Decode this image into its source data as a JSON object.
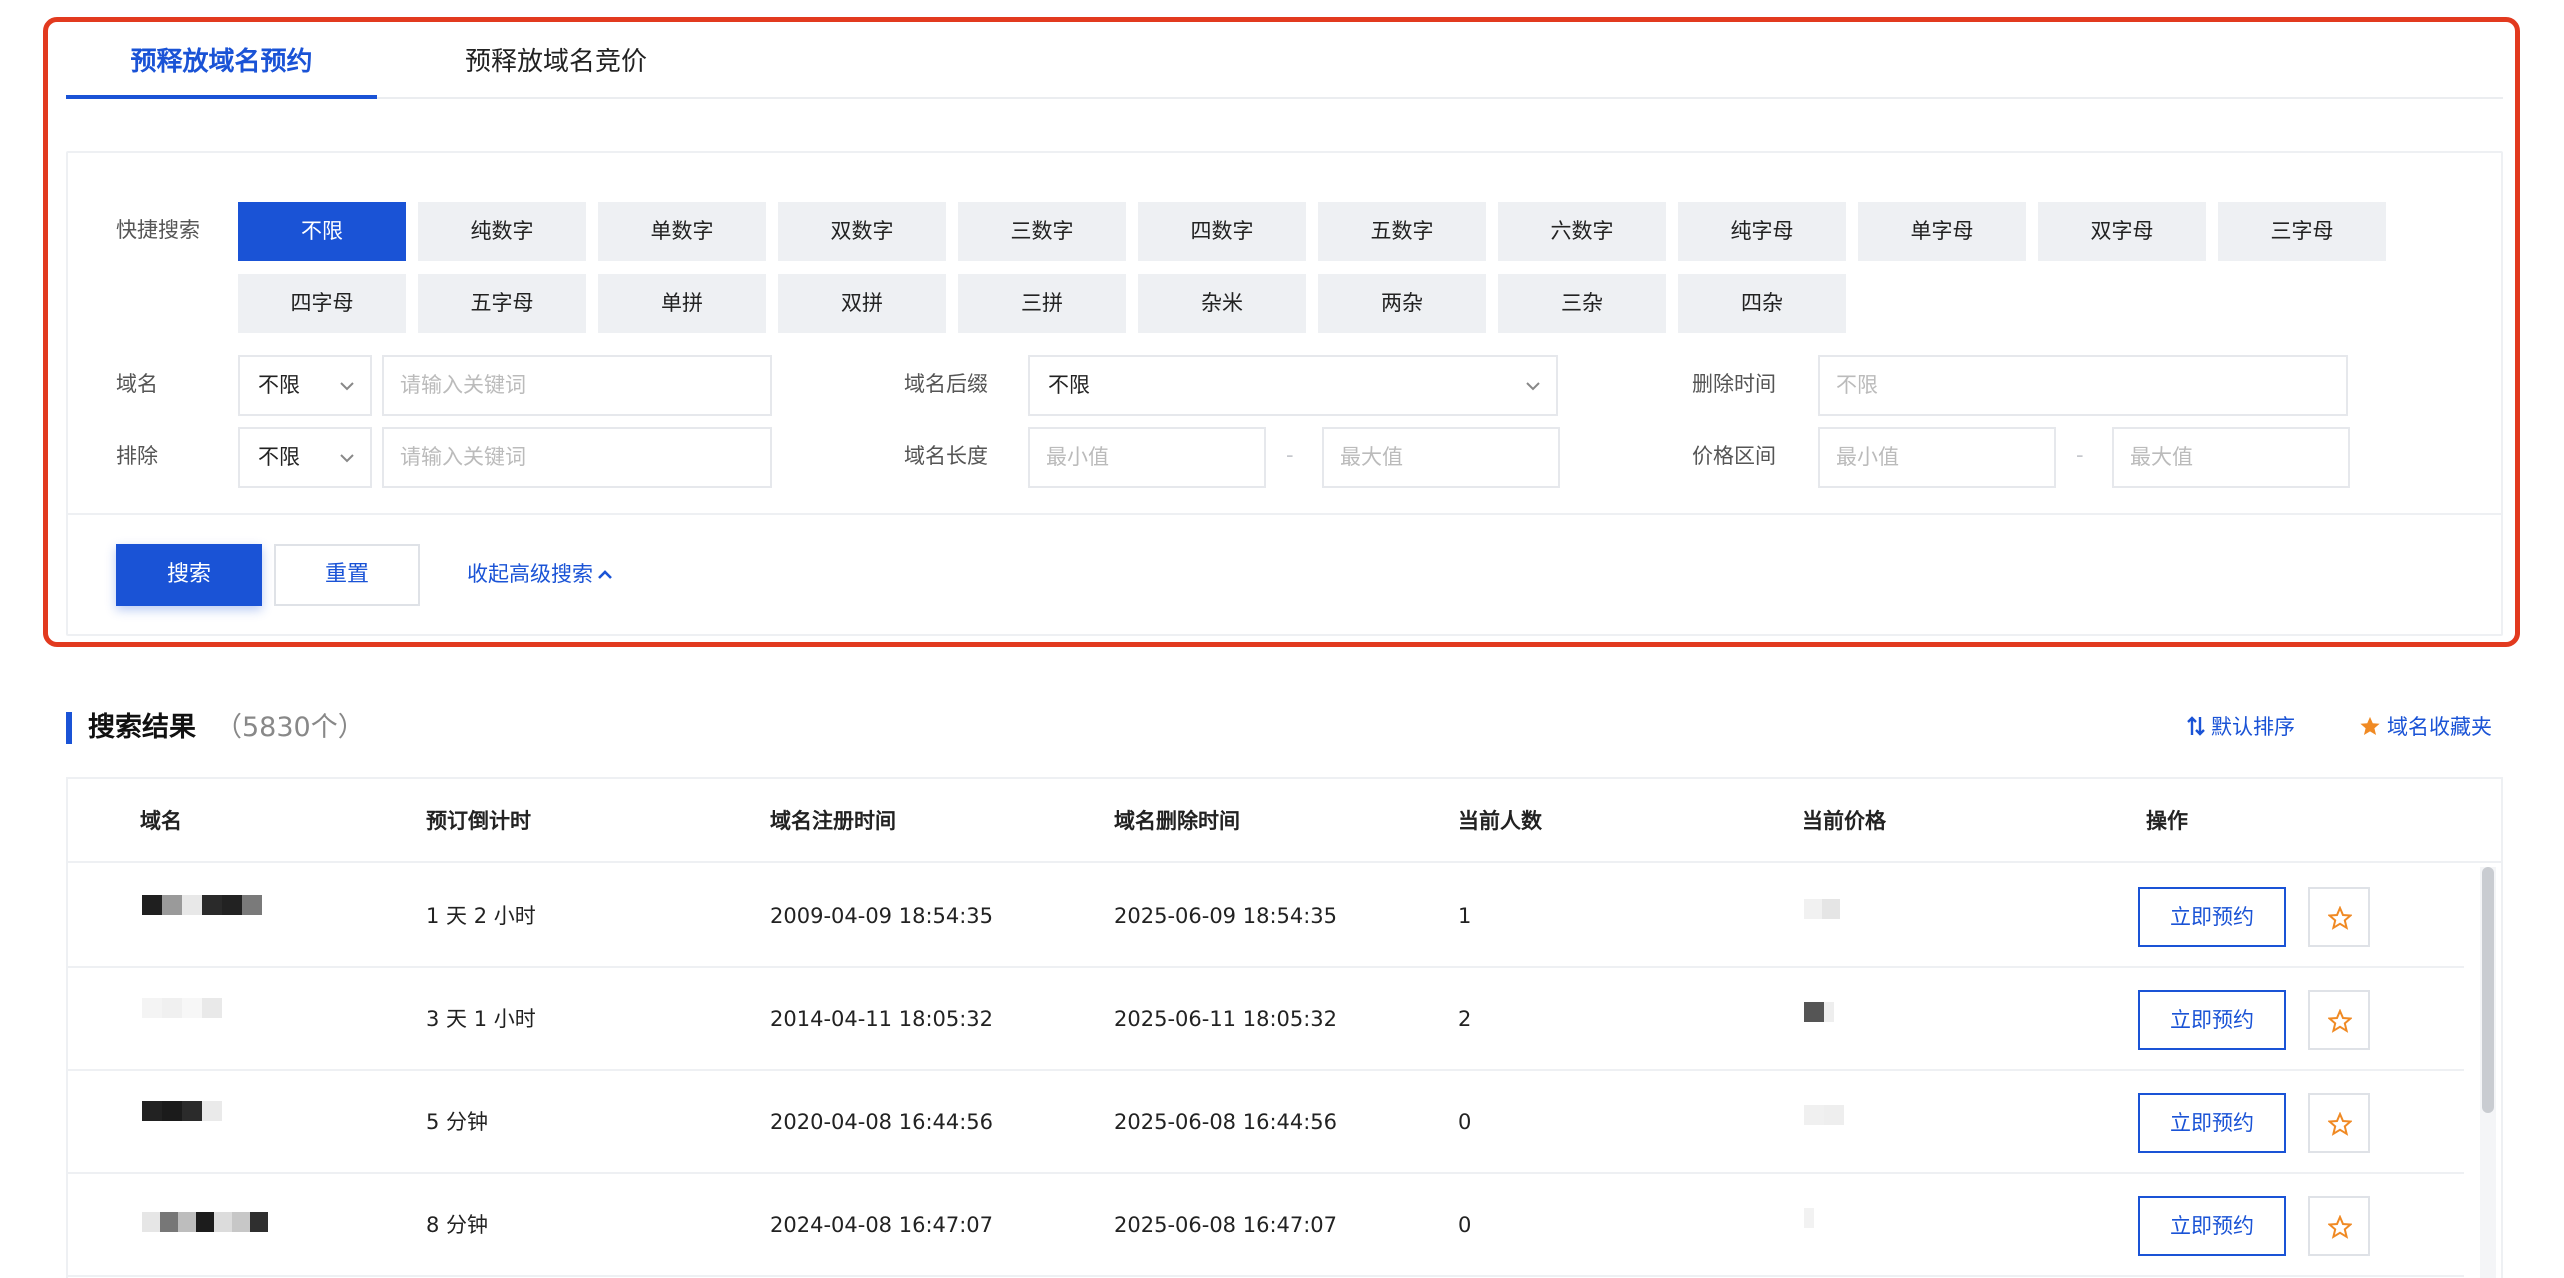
{
  "tabs": [
    {
      "label": "预释放域名预约",
      "active": true
    },
    {
      "label": "预释放域名竞价",
      "active": false
    }
  ],
  "filters": {
    "quick_search_label": "快捷搜索",
    "quick_chips": [
      "不限",
      "纯数字",
      "单数字",
      "双数字",
      "三数字",
      "四数字",
      "五数字",
      "六数字",
      "纯字母",
      "单字母",
      "双字母",
      "三字母",
      "四字母",
      "五字母",
      "单拼",
      "双拼",
      "三拼",
      "杂米",
      "两杂",
      "三杂",
      "四杂"
    ],
    "active_chip": "不限",
    "domain_label": "域名",
    "domain_select": "不限",
    "domain_placeholder": "请输入关键词",
    "exclude_label": "排除",
    "exclude_select": "不限",
    "exclude_placeholder": "请输入关键词",
    "suffix_label": "域名后缀",
    "suffix_select": "不限",
    "length_label": "域名长度",
    "length_min_placeholder": "最小值",
    "length_max_placeholder": "最大值",
    "delete_time_label": "删除时间",
    "delete_time_placeholder": "不限",
    "price_label": "价格区间",
    "price_min_placeholder": "最小值",
    "price_max_placeholder": "最大值",
    "range_separator": "-"
  },
  "actions": {
    "search": "搜索",
    "reset": "重置",
    "collapse": "收起高级搜索"
  },
  "results": {
    "title": "搜索结果",
    "count": "（5830个）",
    "sort_label": "默认排序",
    "favorites_label": "域名收藏夹"
  },
  "table": {
    "columns": [
      "域名",
      "预订倒计时",
      "域名注册时间",
      "域名删除时间",
      "当前人数",
      "当前价格",
      "操作"
    ],
    "reserve_label": "立即预约",
    "rows": [
      {
        "countdown": "1 天 2 小时",
        "registered": "2009-04-09 18:54:35",
        "deleted": "2025-06-09 18:54:35",
        "people": "1"
      },
      {
        "countdown": "3 天 1 小时",
        "registered": "2014-04-11 18:05:32",
        "deleted": "2025-06-11 18:05:32",
        "people": "2"
      },
      {
        "countdown": "5 分钟",
        "registered": "2020-04-08 16:44:56",
        "deleted": "2025-06-08 16:44:56",
        "people": "0"
      },
      {
        "countdown": "8 分钟",
        "registered": "2024-04-08 16:47:07",
        "deleted": "2025-06-08 16:47:07",
        "people": "0"
      }
    ]
  },
  "colors": {
    "primary": "#1a53d6",
    "highlight_frame": "#e23a1f",
    "star": "#f08a24"
  }
}
